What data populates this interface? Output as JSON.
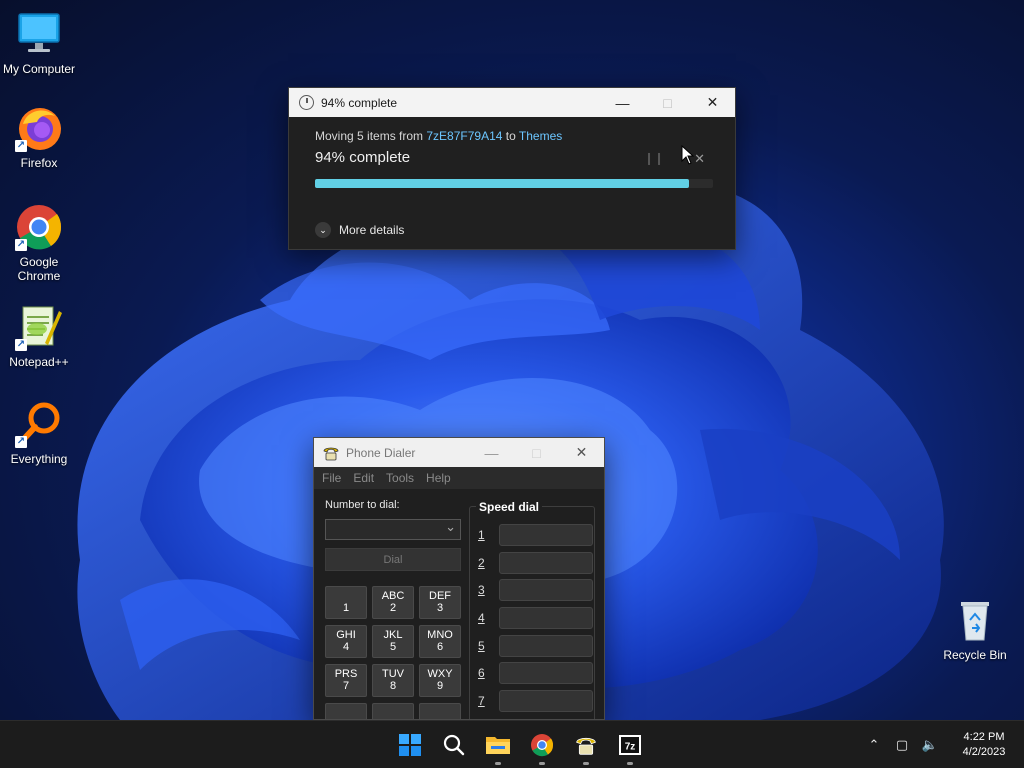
{
  "desktop": {
    "icons": [
      {
        "label": "My Computer"
      },
      {
        "label": "Firefox"
      },
      {
        "label": "Google Chrome"
      },
      {
        "label": "Notepad++"
      },
      {
        "label": "Everything"
      },
      {
        "label": "Recycle Bin"
      }
    ]
  },
  "copy_dialog": {
    "title": "94% complete",
    "moving_prefix": "Moving 5 items from ",
    "source": "7zE87F79A14",
    "to_word": " to ",
    "destination": "Themes",
    "status": "94% complete",
    "progress_percent": 94,
    "progress_color": "#61d0e5",
    "pause_icon": "pause-icon",
    "cancel_icon": "close-icon",
    "more_details": "More details"
  },
  "phone_dialer": {
    "title": "Phone Dialer",
    "menu": [
      "File",
      "Edit",
      "Tools",
      "Help"
    ],
    "number_label": "Number to dial:",
    "number_value": "",
    "dial_label": "Dial",
    "keys": [
      {
        "letters": "",
        "digit": "1"
      },
      {
        "letters": "ABC",
        "digit": "2"
      },
      {
        "letters": "DEF",
        "digit": "3"
      },
      {
        "letters": "GHI",
        "digit": "4"
      },
      {
        "letters": "JKL",
        "digit": "5"
      },
      {
        "letters": "MNO",
        "digit": "6"
      },
      {
        "letters": "PRS",
        "digit": "7"
      },
      {
        "letters": "TUV",
        "digit": "8"
      },
      {
        "letters": "WXY",
        "digit": "9"
      }
    ],
    "speed_dial_title": "Speed dial",
    "speed_dial_numbers": [
      "1",
      "2",
      "3",
      "4",
      "5",
      "6",
      "7"
    ]
  },
  "taskbar": {
    "apps": [
      "start-icon",
      "search-icon",
      "file-explorer-icon",
      "chrome-icon",
      "phone-dialer-icon",
      "7zip-icon"
    ],
    "time": "4:22 PM",
    "date": "4/2/2023"
  }
}
